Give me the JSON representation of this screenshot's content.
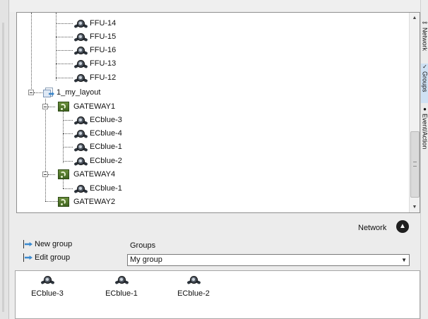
{
  "tree": {
    "items": [
      {
        "label": "FFU-14",
        "type": "device"
      },
      {
        "label": "FFU-15",
        "type": "device"
      },
      {
        "label": "FFU-16",
        "type": "device"
      },
      {
        "label": "FFU-13",
        "type": "device"
      },
      {
        "label": "FFU-12",
        "type": "device"
      },
      {
        "label": "1_my_layout",
        "type": "layout"
      },
      {
        "label": "GATEWAY1",
        "type": "gateway"
      },
      {
        "label": "ECblue-3",
        "type": "device"
      },
      {
        "label": "ECblue-4",
        "type": "device"
      },
      {
        "label": "ECblue-1",
        "type": "device"
      },
      {
        "label": "ECblue-2",
        "type": "device"
      },
      {
        "label": "GATEWAY4",
        "type": "gateway"
      },
      {
        "label": "ECblue-1",
        "type": "device"
      },
      {
        "label": "GATEWAY2",
        "type": "gateway"
      }
    ]
  },
  "network": {
    "label": "Network",
    "button_icon": "chevron-up-icon"
  },
  "actions": {
    "new_group": "New group",
    "edit_group": "Edit group"
  },
  "groups": {
    "label": "Groups",
    "selected": "My group"
  },
  "members": [
    "ECblue-3",
    "ECblue-1",
    "ECblue-2"
  ],
  "tabs": {
    "network": "Network",
    "groups": "Groups",
    "event_action": "Event/Action"
  },
  "colors": {
    "accent": "#3a8ad0",
    "gateway": "#4f7a2a",
    "tab_active": "#cfe1f3"
  }
}
